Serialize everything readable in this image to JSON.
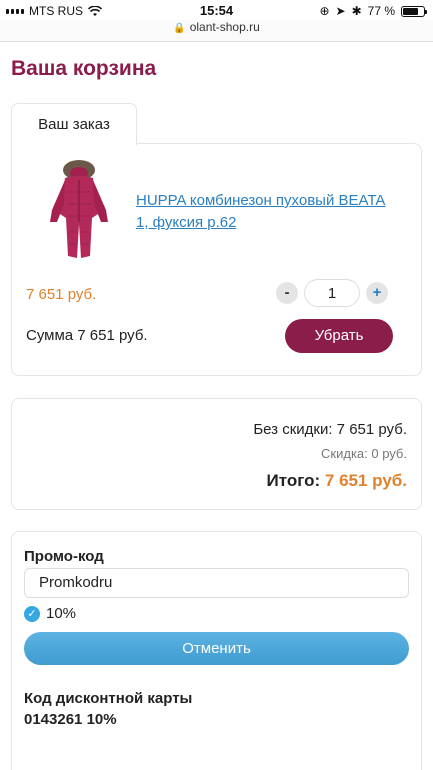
{
  "status_bar": {
    "carrier": "MTS RUS",
    "time": "15:54",
    "battery": "77 %",
    "battery_level": 0.77
  },
  "url_bar": {
    "domain": "olant-shop.ru"
  },
  "page": {
    "title": "Ваша корзина"
  },
  "order_tab": {
    "label": "Ваш заказ"
  },
  "cart_item": {
    "name": "HUPPA комбинезон пуховый BEATA 1, фуксия р.62",
    "price": "7 651 руб.",
    "quantity": "1",
    "minus": "-",
    "plus": "+",
    "sum": "Сумма 7 651 руб.",
    "remove_label": "Убрать"
  },
  "totals": {
    "without_discount": "Без скидки: 7 651 руб.",
    "discount": "Скидка: 0 руб.",
    "total_label": "Итого:",
    "total_value": "7 651 руб."
  },
  "promo": {
    "title": "Промо-код",
    "code": "Promkodru",
    "percent": "10%",
    "cancel_label": "Отменить"
  },
  "discount_card": {
    "title": "Код дисконтной карты",
    "value": "0143261 10%"
  },
  "colors": {
    "brand": "#8b1d4b",
    "price": "#e0822d",
    "link": "#2a7fc1",
    "button_blue": "#4fa8d8"
  }
}
